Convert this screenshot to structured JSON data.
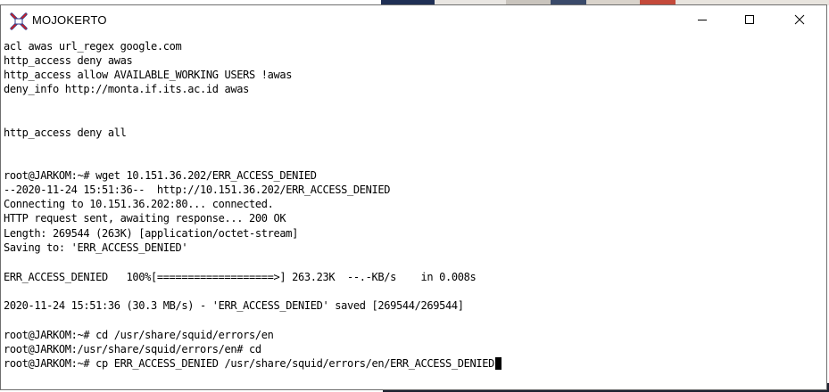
{
  "window": {
    "title": "MOJOKERTO",
    "icon": "putty-app-icon",
    "controls": {
      "minimize": "minimize-icon",
      "maximize": "maximize-icon",
      "close": "close-icon"
    }
  },
  "terminal": {
    "lines": [
      "acl awas url_regex google.com",
      "http_access deny awas",
      "http_access allow AVAILABLE_WORKING USERS !awas",
      "deny_info http://monta.if.its.ac.id awas",
      "",
      "",
      "http_access deny all",
      "",
      "",
      "root@JARKOM:~# wget 10.151.36.202/ERR_ACCESS_DENIED",
      "--2020-11-24 15:51:36--  http://10.151.36.202/ERR_ACCESS_DENIED",
      "Connecting to 10.151.36.202:80... connected.",
      "HTTP request sent, awaiting response... 200 OK",
      "Length: 269544 (263K) [application/octet-stream]",
      "Saving to: 'ERR_ACCESS_DENIED'",
      "",
      "ERR_ACCESS_DENIED   100%[===================>] 263.23K  --.-KB/s    in 0.008s",
      "",
      "2020-11-24 15:51:36 (30.3 MB/s) - 'ERR_ACCESS_DENIED' saved [269544/269544]",
      "",
      "root@JARKOM:~# cd /usr/share/squid/errors/en",
      "root@JARKOM:/usr/share/squid/errors/en# cd",
      "root@JARKOM:~# cp ERR_ACCESS_DENIED /usr/share/squid/errors/en/ERR_ACCESS_DENIED"
    ],
    "cursor_line": 22
  },
  "colors": {
    "terminal_bg": "#ffffff",
    "terminal_fg": "#000000",
    "icon_red": "#d42020",
    "icon_blue": "#2b3a8c"
  }
}
